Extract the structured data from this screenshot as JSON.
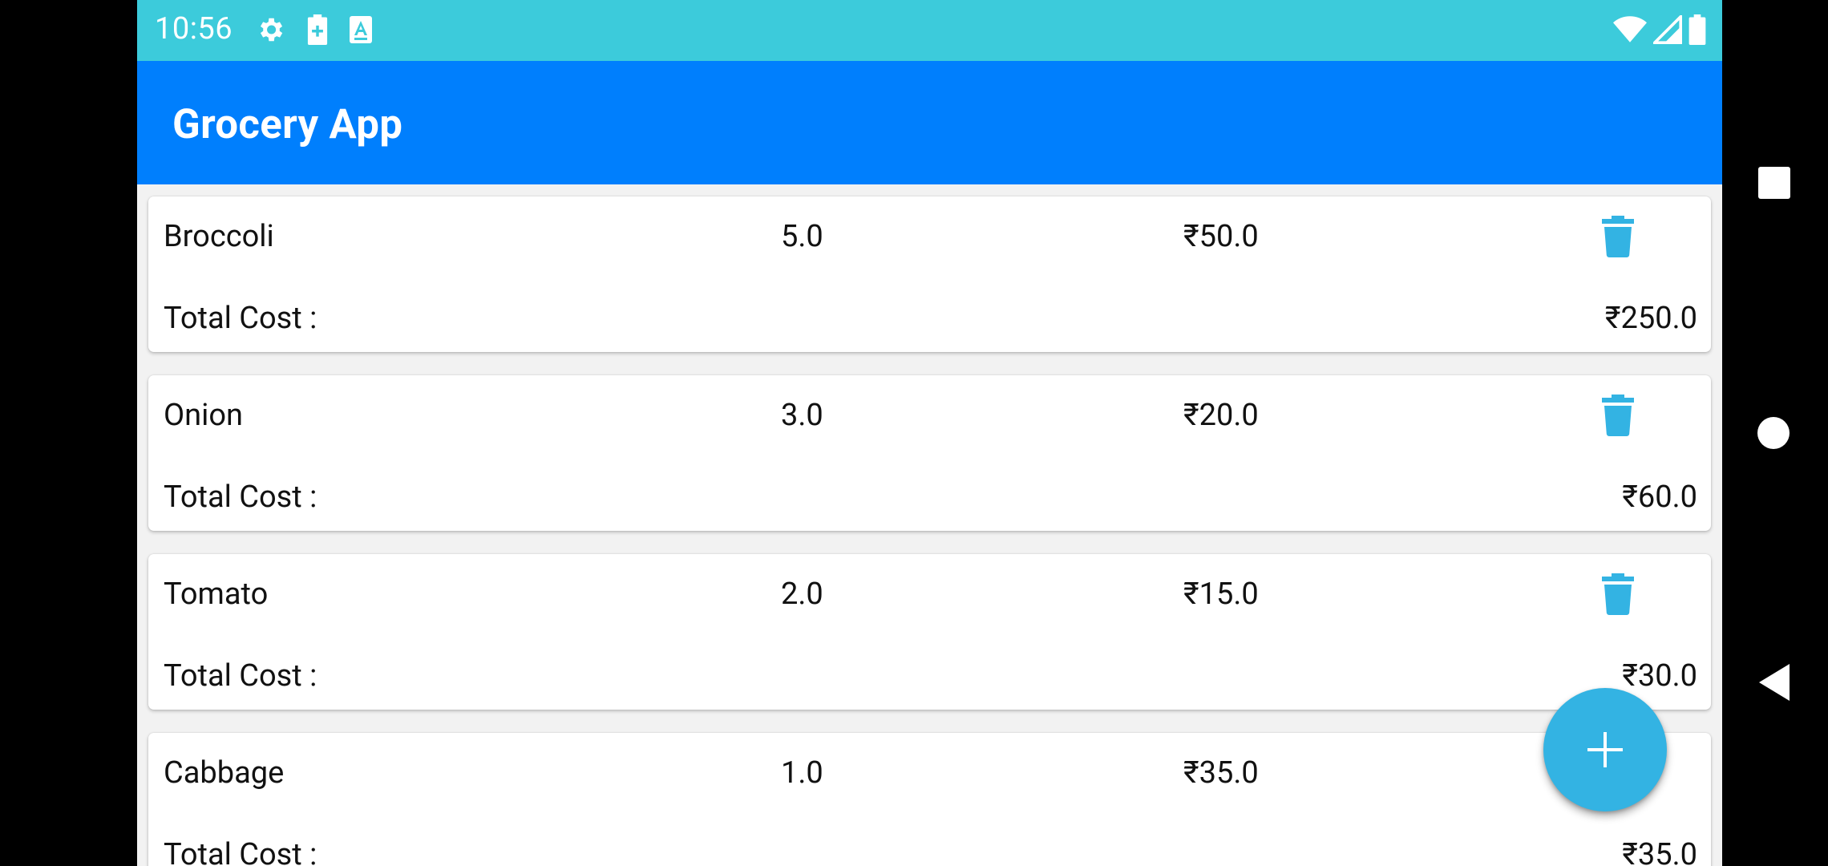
{
  "status_bar": {
    "time": "10:56",
    "left_icons": [
      "gear-icon",
      "battery-saver-icon",
      "font-a-icon"
    ],
    "right_icons": [
      "wifi-icon",
      "signal-icon",
      "battery-icon"
    ],
    "color": "#3ccbdb"
  },
  "app_bar": {
    "title": "Grocery App",
    "color": "#007ffd"
  },
  "items": [
    {
      "name": "Broccoli",
      "quantity": "5.0",
      "price": "₹50.0",
      "total_label": "Total Cost :",
      "total": "₹250.0"
    },
    {
      "name": "Onion",
      "quantity": "3.0",
      "price": "₹20.0",
      "total_label": "Total Cost :",
      "total": "₹60.0"
    },
    {
      "name": "Tomato",
      "quantity": "2.0",
      "price": "₹15.0",
      "total_label": "Total Cost :",
      "total": "₹30.0"
    },
    {
      "name": "Cabbage",
      "quantity": "1.0",
      "price": "₹35.0",
      "total_label": "Total Cost :",
      "total": "₹35.0"
    }
  ],
  "delete_icon": "trash-icon",
  "delete_color": "#33b3e3",
  "fab": {
    "icon": "plus-icon",
    "color": "#33b3e3"
  },
  "nav_bar": [
    "recents-square-icon",
    "home-circle-icon",
    "back-triangle-icon"
  ]
}
